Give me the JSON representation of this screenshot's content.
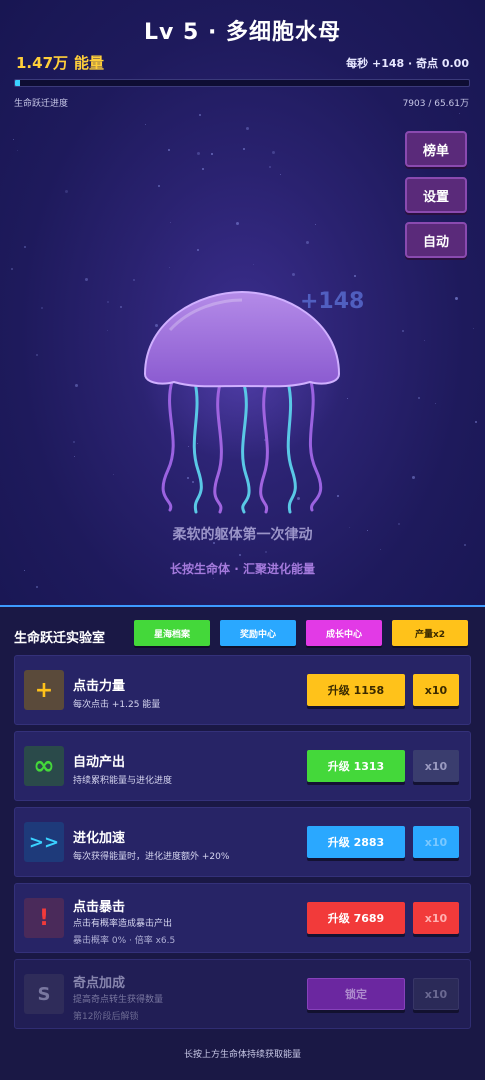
{
  "header": {
    "title": "Lv 5 · 多细胞水母",
    "energy_value": "1.47万",
    "energy_label": "能量",
    "rates": "每秒 +148 · 奇点 0.00",
    "progress_label": "生命跃迁进度",
    "progress_value": "7903 / 65.61万",
    "progress_fraction": 0.012
  },
  "side_buttons": {
    "ranking": "榜单",
    "settings": "设置",
    "auto": "自动"
  },
  "scene": {
    "float_gain": "+148",
    "caption": "柔软的躯体第一次律动",
    "hint": "长按生命体 · 汇聚进化能量"
  },
  "lab": {
    "title": "生命跃迁实验室",
    "chips": [
      {
        "label": "星海档案",
        "color": "#44d83a"
      },
      {
        "label": "奖励中心",
        "color": "#2aa8ff"
      },
      {
        "label": "成长中心",
        "color": "#e23ae6"
      },
      {
        "label": "产量x2",
        "color": "#ffc21a"
      }
    ],
    "upgrades": [
      {
        "icon": "plus-icon",
        "name": "点击力量",
        "desc": "每次点击 +1.25 能量",
        "button": "升级 1158",
        "button_color": "#ffc21a",
        "x10": "x10",
        "x10_color": "#ffc21a"
      },
      {
        "icon": "infinity-icon",
        "name": "自动产出",
        "desc": "持续累积能量与进化进度",
        "button": "升级 1313",
        "button_color": "#44d83a",
        "x10": "x10",
        "x10_color": "#3a3d6e"
      },
      {
        "icon": "fast-forward-icon",
        "name": "进化加速",
        "desc": "每次获得能量时，进化进度额外 +20%",
        "button": "升级 2883",
        "button_color": "#2aa8ff",
        "x10": "x10",
        "x10_color": "#2aa8ff"
      },
      {
        "icon": "exclamation-icon",
        "name": "点击暴击",
        "desc": "点击有概率造成暴击产出",
        "sub": "暴击概率 0% · 倍率 x6.5",
        "button": "升级 7689",
        "button_color": "#f23a3a",
        "x10": "x10",
        "x10_color": "#f23a3a"
      },
      {
        "icon": "s-letter-icon",
        "name": "奇点加成",
        "desc": "提高奇点转生获得数量",
        "sub": "第12阶段后解锁",
        "button": "锁定",
        "button_color": "#7a2ab0",
        "x10": "x10",
        "x10_color": "#2e2e5c",
        "locked": true
      }
    ],
    "footer": "长按上方生命体持续获取能量"
  }
}
